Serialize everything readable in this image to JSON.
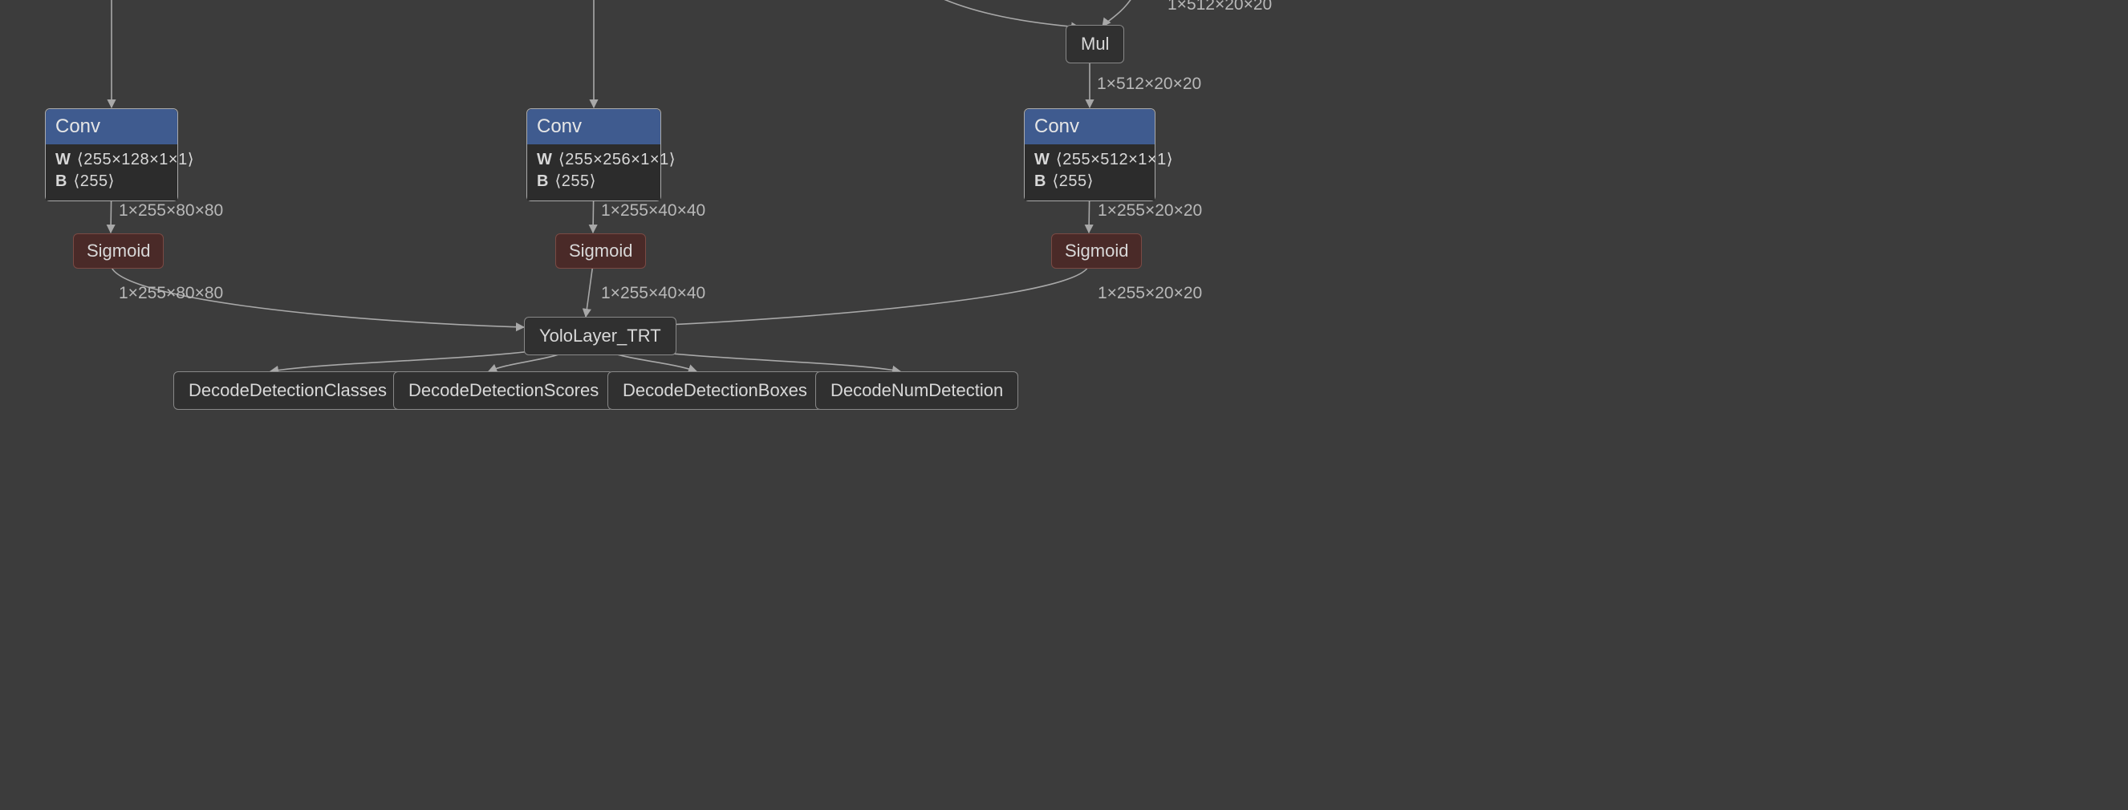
{
  "nodes": {
    "mul": {
      "label": "Mul"
    },
    "conv1": {
      "title": "Conv",
      "w_label": "W",
      "w": "⟨255×128×1×1⟩",
      "b_label": "B",
      "b": "⟨255⟩"
    },
    "conv2": {
      "title": "Conv",
      "w_label": "W",
      "w": "⟨255×256×1×1⟩",
      "b_label": "B",
      "b": "⟨255⟩"
    },
    "conv3": {
      "title": "Conv",
      "w_label": "W",
      "w": "⟨255×512×1×1⟩",
      "b_label": "B",
      "b": "⟨255⟩"
    },
    "sig1": {
      "label": "Sigmoid"
    },
    "sig2": {
      "label": "Sigmoid"
    },
    "sig3": {
      "label": "Sigmoid"
    },
    "yolo": {
      "label": "YoloLayer_TRT"
    },
    "dec_classes": {
      "label": "DecodeDetectionClasses"
    },
    "dec_scores": {
      "label": "DecodeDetectionScores"
    },
    "dec_boxes": {
      "label": "DecodeDetectionBoxes"
    },
    "dec_num": {
      "label": "DecodeNumDetection"
    }
  },
  "edge_labels": {
    "top_right": "1×512×20×20",
    "mul_conv3": "1×512×20×20",
    "conv1_sig1": "1×255×80×80",
    "conv2_sig2": "1×255×40×40",
    "conv3_sig3": "1×255×20×20",
    "sig1_out": "1×255×80×80",
    "sig2_out": "1×255×40×40",
    "sig3_out": "1×255×20×20"
  }
}
